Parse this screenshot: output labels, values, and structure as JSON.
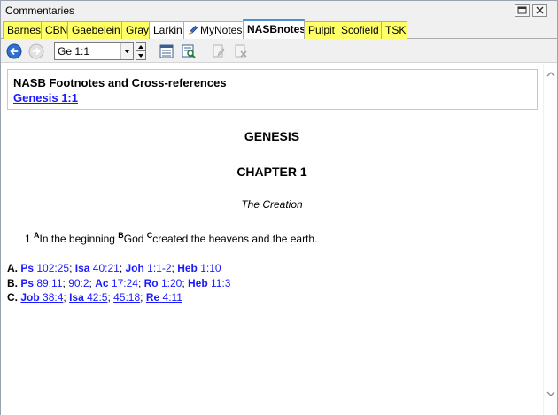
{
  "window": {
    "title": "Commentaries"
  },
  "tabs": [
    {
      "label": "Barnes",
      "style": "yellow"
    },
    {
      "label": "CBN",
      "style": "yellow"
    },
    {
      "label": "Gaebelein",
      "style": "yellow"
    },
    {
      "label": "Gray",
      "style": "yellow"
    },
    {
      "label": "Larkin",
      "style": "white"
    },
    {
      "label": "MyNotes",
      "style": "white",
      "icon": "pencil-icon"
    },
    {
      "label": "NASBnotes",
      "style": "active"
    },
    {
      "label": "Pulpit",
      "style": "yellow"
    },
    {
      "label": "Scofield",
      "style": "yellow"
    },
    {
      "label": "TSK",
      "style": "yellow"
    }
  ],
  "toolbar": {
    "reference_value": "Ge 1:1",
    "icons": [
      "back-arrow-icon",
      "forward-arrow-icon",
      "list-view-icon",
      "search-view-icon",
      "edit-note-icon",
      "delete-note-icon"
    ]
  },
  "content": {
    "header_title": "NASB Footnotes and Cross-references",
    "header_ref": "Genesis 1:1",
    "book": "GENESIS",
    "chapter": "CHAPTER 1",
    "heading": "The Creation",
    "verse": {
      "number": "1",
      "sup_a": "A",
      "text_a": "In the beginning ",
      "sup_b": "B",
      "text_b": "God ",
      "sup_c": "C",
      "text_c": "created the heavens and the earth."
    },
    "notes": [
      {
        "letter": "A.",
        "refs": [
          {
            "book": "Ps",
            "ref": "102:25"
          },
          {
            "book": "Isa",
            "ref": "40:21"
          },
          {
            "book": "Joh",
            "ref": "1:1-2"
          },
          {
            "book": "Heb",
            "ref": "1:10"
          }
        ]
      },
      {
        "letter": "B.",
        "refs": [
          {
            "book": "Ps",
            "ref": "89:11"
          },
          {
            "book": "",
            "ref": "90:2"
          },
          {
            "book": "Ac",
            "ref": "17:24"
          },
          {
            "book": "Ro",
            "ref": "1:20"
          },
          {
            "book": "Heb",
            "ref": "11:3"
          }
        ]
      },
      {
        "letter": "C.",
        "refs": [
          {
            "book": "Job",
            "ref": "38:4"
          },
          {
            "book": "Isa",
            "ref": "42:5"
          },
          {
            "book": "",
            "ref": "45:18"
          },
          {
            "book": "Re",
            "ref": "4:11"
          }
        ]
      }
    ]
  },
  "colors": {
    "tab_yellow": "#ffff66",
    "link": "#1a1aff",
    "active_tab_accent": "#4a90d9"
  }
}
